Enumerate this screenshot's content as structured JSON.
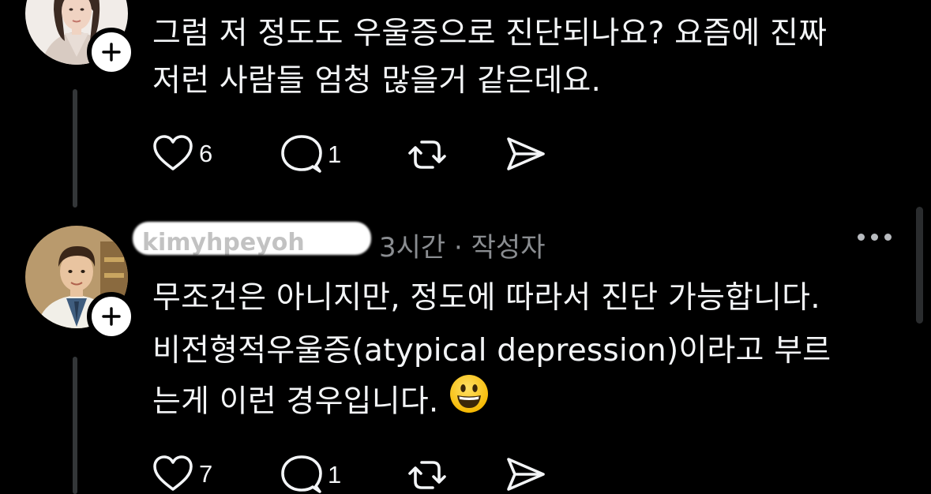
{
  "post1": {
    "lines": [
      "그럼 저 정도도 우울증으로 진단되나요? 요즘에 진짜",
      "저런 사람들 엄청 많을거 같은데요."
    ],
    "likes": "6",
    "replies": "1"
  },
  "post2": {
    "username": "kimyhpeyoh",
    "time": "3시간",
    "separator": "·",
    "author_tag": "작성자",
    "lines": [
      "무조건은 아니지만, 정도에 따라서 진단 가능합니다.",
      "비전형적우울증(atypical depression)이라고 부르",
      "는게 이런 경우입니다."
    ],
    "likes": "7",
    "replies": "1"
  },
  "icons": {
    "like": "heart-icon",
    "reply": "comment-icon",
    "repost": "repost-icon",
    "share": "send-icon",
    "follow": "plus-icon",
    "more": "more-horizontal-icon",
    "emoji": "grinning-face-emoji"
  },
  "colors": {
    "background": "#000000",
    "text": "#f3f5f7",
    "secondary": "#8a8d91"
  }
}
